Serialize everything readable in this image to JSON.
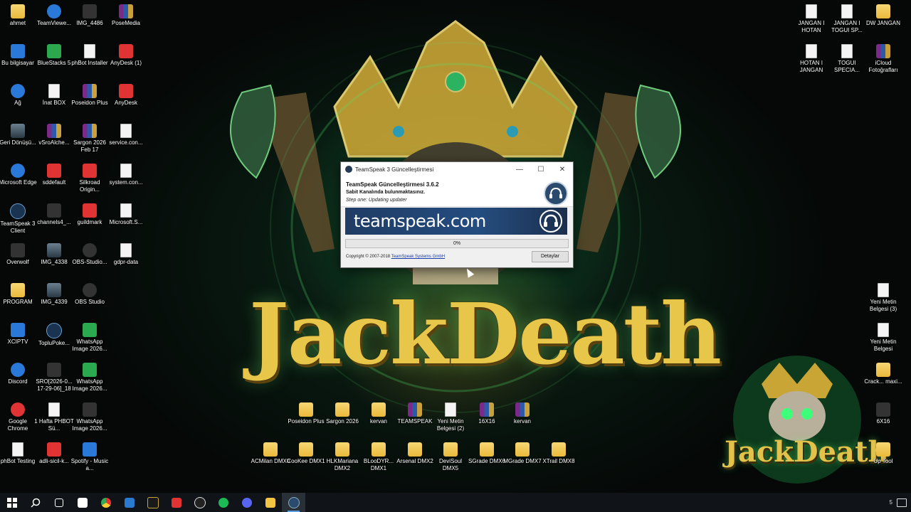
{
  "wallpaper": {
    "title": "JackDeath",
    "mini_title": "JackDeath"
  },
  "desktop_icons": [
    {
      "label": "ahmet",
      "icon": "folder-icon"
    },
    {
      "label": "TeamViewe...",
      "icon": "teamviewer-icon"
    },
    {
      "label": "IMG_4486",
      "icon": "image-icon"
    },
    {
      "label": "PoseMedia",
      "icon": "winrar-icon"
    },
    {
      "label": "Bu bilgisayar",
      "icon": "computer-icon"
    },
    {
      "label": "BlueStacks 5",
      "icon": "bluestacks-icon"
    },
    {
      "label": "phBot Installer",
      "icon": "phbot-icon"
    },
    {
      "label": "AnyDesk (1)",
      "icon": "anydesk-icon"
    },
    {
      "label": "Ağ",
      "icon": "network-icon"
    },
    {
      "label": "İnat BOX",
      "icon": "app-icon"
    },
    {
      "label": "Poseidon Plus",
      "icon": "winrar-icon"
    },
    {
      "label": "AnyDesk",
      "icon": "anydesk-icon"
    },
    {
      "label": "Geri Dönüşü...",
      "icon": "recycle-bin-icon"
    },
    {
      "label": "vSroAlche...",
      "icon": "winrar-icon"
    },
    {
      "label": "Sargon 2026 Feb 17",
      "icon": "winrar-icon"
    },
    {
      "label": "service.con...",
      "icon": "document-icon"
    },
    {
      "label": "Microsoft Edge",
      "icon": "edge-icon"
    },
    {
      "label": "sddefault",
      "icon": "image-icon"
    },
    {
      "label": "Silkroad Origin...",
      "icon": "silkroad-icon"
    },
    {
      "label": "system.con...",
      "icon": "document-icon"
    },
    {
      "label": "TeamSpeak 3 Client",
      "icon": "teamspeak-icon"
    },
    {
      "label": "channels4_...",
      "icon": "image-icon"
    },
    {
      "label": "guildmark",
      "icon": "image-icon"
    },
    {
      "label": "Microsoft.S...",
      "icon": "document-icon"
    },
    {
      "label": "Overwolf",
      "icon": "overwolf-icon"
    },
    {
      "label": "IMG_4338",
      "icon": "image-icon"
    },
    {
      "label": "OBS-Studio...",
      "icon": "obs-icon"
    },
    {
      "label": "gdpr-data",
      "icon": "document-icon"
    },
    {
      "label": "PROGRAM",
      "icon": "folder-icon"
    },
    {
      "label": "IMG_4339",
      "icon": "image-icon"
    },
    {
      "label": "OBS Studio",
      "icon": "obs-icon"
    },
    {
      "label": "XCIPTV",
      "icon": "app-icon"
    },
    {
      "label": "TopluPoke...",
      "icon": "teamspeak-icon"
    },
    {
      "label": "WhatsApp Image 2026...",
      "icon": "image-icon"
    },
    {
      "label": "Discord",
      "icon": "discord-icon"
    },
    {
      "label": "SRO[2026-0... 17-29-06]_18",
      "icon": "image-icon"
    },
    {
      "label": "WhatsApp Image 2026...",
      "icon": "image-icon"
    },
    {
      "label": "Google Chrome",
      "icon": "chrome-icon"
    },
    {
      "label": "1 Hafta PHBOT Sü...",
      "icon": "document-icon"
    },
    {
      "label": "WhatsApp Image 2026...",
      "icon": "image-icon"
    },
    {
      "label": "phBot Testing",
      "icon": "phbot-icon"
    },
    {
      "label": "adli-sicil-k...",
      "icon": "pdf-icon"
    },
    {
      "label": "Spotify - Music a...",
      "icon": "installer-icon"
    },
    {
      "label": "JANGAN I HOTAN",
      "icon": "document-icon"
    },
    {
      "label": "JANGAN I TOGUI SP...",
      "icon": "document-icon"
    },
    {
      "label": "DW JANGAN",
      "icon": "folder-icon"
    },
    {
      "label": "HOTAN I JANGAN",
      "icon": "document-icon"
    },
    {
      "label": "TOGUI SPECIA...",
      "icon": "document-icon"
    },
    {
      "label": "iCloud Fotoğrafları",
      "icon": "winrar-icon"
    },
    {
      "label": "Yeni Metin Belgesi (3)",
      "icon": "document-icon"
    },
    {
      "label": "Yeni Metin Belgesi",
      "icon": "document-icon"
    },
    {
      "label": "Crack... maxi...",
      "icon": "folder-icon"
    },
    {
      "label": "6X16",
      "icon": "image-icon"
    },
    {
      "label": "Up Tool",
      "icon": "folder-icon"
    },
    {
      "label": "Poseidon Plus",
      "icon": "folder-icon"
    },
    {
      "label": "Sargon 2026",
      "icon": "folder-icon"
    },
    {
      "label": "kervan",
      "icon": "folder-icon"
    },
    {
      "label": "TEAMSPEAK",
      "icon": "winrar-icon"
    },
    {
      "label": "Yeni Metin Belgesi (2)",
      "icon": "document-icon"
    },
    {
      "label": "16X16",
      "icon": "winrar-icon"
    },
    {
      "label": "kervan",
      "icon": "winrar-icon"
    },
    {
      "label": "ACMilan DMX0",
      "icon": "folder-icon"
    },
    {
      "label": "CooKee DMX1",
      "icon": "folder-icon"
    },
    {
      "label": "HLKMariana DMX2",
      "icon": "folder-icon"
    },
    {
      "label": "BLooDYR... DMX1",
      "icon": "folder-icon"
    },
    {
      "label": "Arsenal DMX2",
      "icon": "folder-icon"
    },
    {
      "label": "DeviSoul DMX5",
      "icon": "folder-icon"
    },
    {
      "label": "SGrade DMX6",
      "icon": "folder-icon"
    },
    {
      "label": "MGrade DMX7",
      "icon": "folder-icon"
    },
    {
      "label": "XTrail DMX8",
      "icon": "folder-icon"
    }
  ],
  "dialog": {
    "title": "TeamSpeak 3 Güncelleştirmesi",
    "heading": "TeamSpeak Güncelleştirmesi 3.6.2",
    "subheading": "Sabit Kanalında bulunmaktasınız.",
    "step": "Step one: Updating updater",
    "banner_text": "teamspeak.com",
    "progress_text": "0%",
    "progress": 0,
    "copyright_prefix": "Copyright © 2007-2018",
    "copyright_link": "TeamSpeak Systems GmbH",
    "details_button": "Detaylar",
    "minimize": "—",
    "maximize": "☐",
    "close": "✕"
  },
  "taskbar": {
    "items": [
      "start-icon",
      "search-icon",
      "task-view-icon",
      "store-icon",
      "chrome-icon",
      "phbot-icon",
      "app-icon",
      "anydesk-icon",
      "obs-icon",
      "spotify-icon",
      "discord-icon",
      "file-explorer-icon",
      "teamspeak-icon"
    ],
    "right_glyph": "5"
  },
  "colors": {
    "accent": "#5aa0e0",
    "gold": "#e7c64a",
    "banner": "#1f3c64"
  }
}
